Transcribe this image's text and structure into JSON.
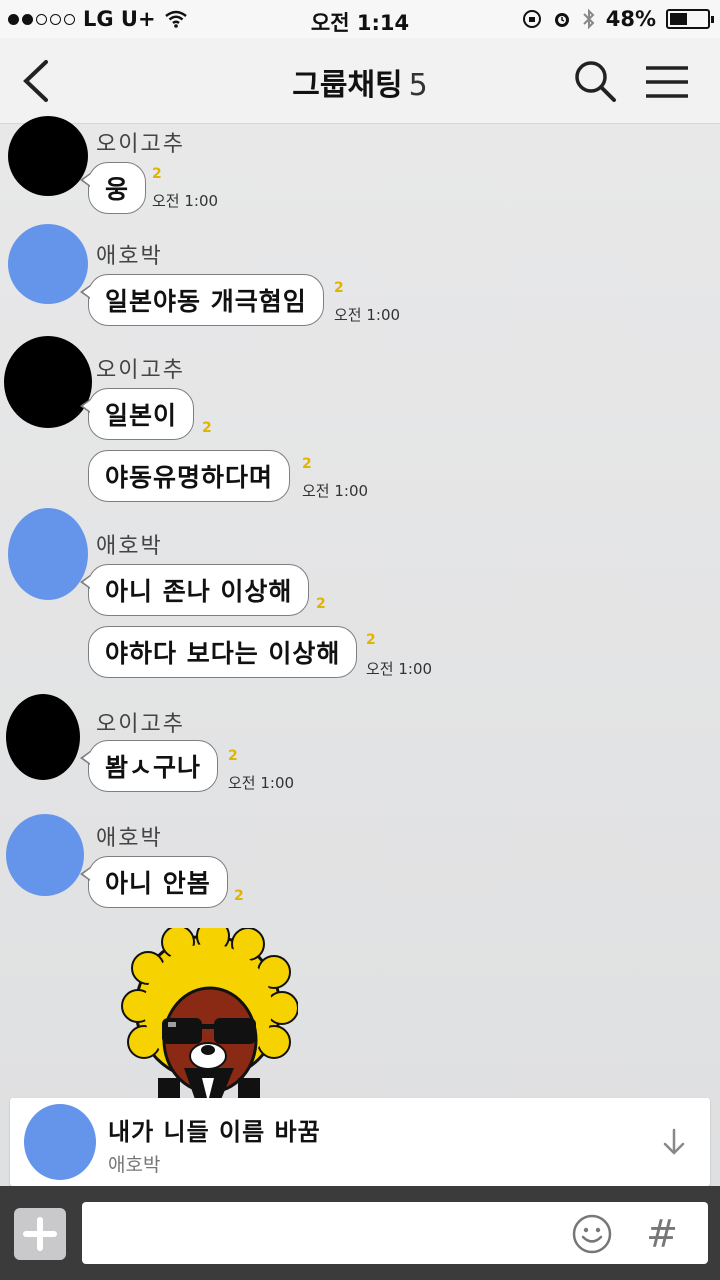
{
  "status_bar": {
    "carrier": "LG U+",
    "time": "오전 1:14",
    "battery": "48%",
    "battery_level": 0.48
  },
  "header": {
    "title": "그룹채팅",
    "member_count": "5"
  },
  "messages": [
    {
      "sender": "오이고추",
      "avatar": "black",
      "bubbles": [
        {
          "text": "웅",
          "unread": "2",
          "time": "오전 1:00"
        }
      ]
    },
    {
      "sender": "애호박",
      "avatar": "blue",
      "bubbles": [
        {
          "text": "일본야동 개극혐임",
          "unread": "2",
          "time": "오전 1:00"
        }
      ]
    },
    {
      "sender": "오이고추",
      "avatar": "black",
      "bubbles": [
        {
          "text": "일본이",
          "unread": "2",
          "time": ""
        },
        {
          "text": "야동유명하다며",
          "unread": "2",
          "time": "오전 1:00"
        }
      ]
    },
    {
      "sender": "애호박",
      "avatar": "blue",
      "bubbles": [
        {
          "text": "아니 존나 이상해",
          "unread": "2",
          "time": ""
        },
        {
          "text": "야하다 보다는 이상해",
          "unread": "2",
          "time": "오전 1:00"
        }
      ]
    },
    {
      "sender": "오이고추",
      "avatar": "black",
      "bubbles": [
        {
          "text": "봠ㅅ구나",
          "unread": "2",
          "time": "오전 1:00"
        }
      ]
    },
    {
      "sender": "애호박",
      "avatar": "blue",
      "bubbles": [
        {
          "text": "아니 안봄",
          "unread": "2",
          "time": ""
        }
      ]
    }
  ],
  "sticker": {
    "icon": "afro-character-sticker-icon"
  },
  "notice": {
    "text": "내가 니들 이름 바꿈",
    "sender": "애호박"
  },
  "input_bar": {
    "plus_icon": "plus-icon",
    "emoji_icon": "smiley-icon",
    "hash_label": "#"
  },
  "colors": {
    "avatar_blue": "#6594eb",
    "avatar_black": "#000000",
    "unread_yellow": "#e0b400",
    "input_bar_bg": "#3b3b3c"
  }
}
